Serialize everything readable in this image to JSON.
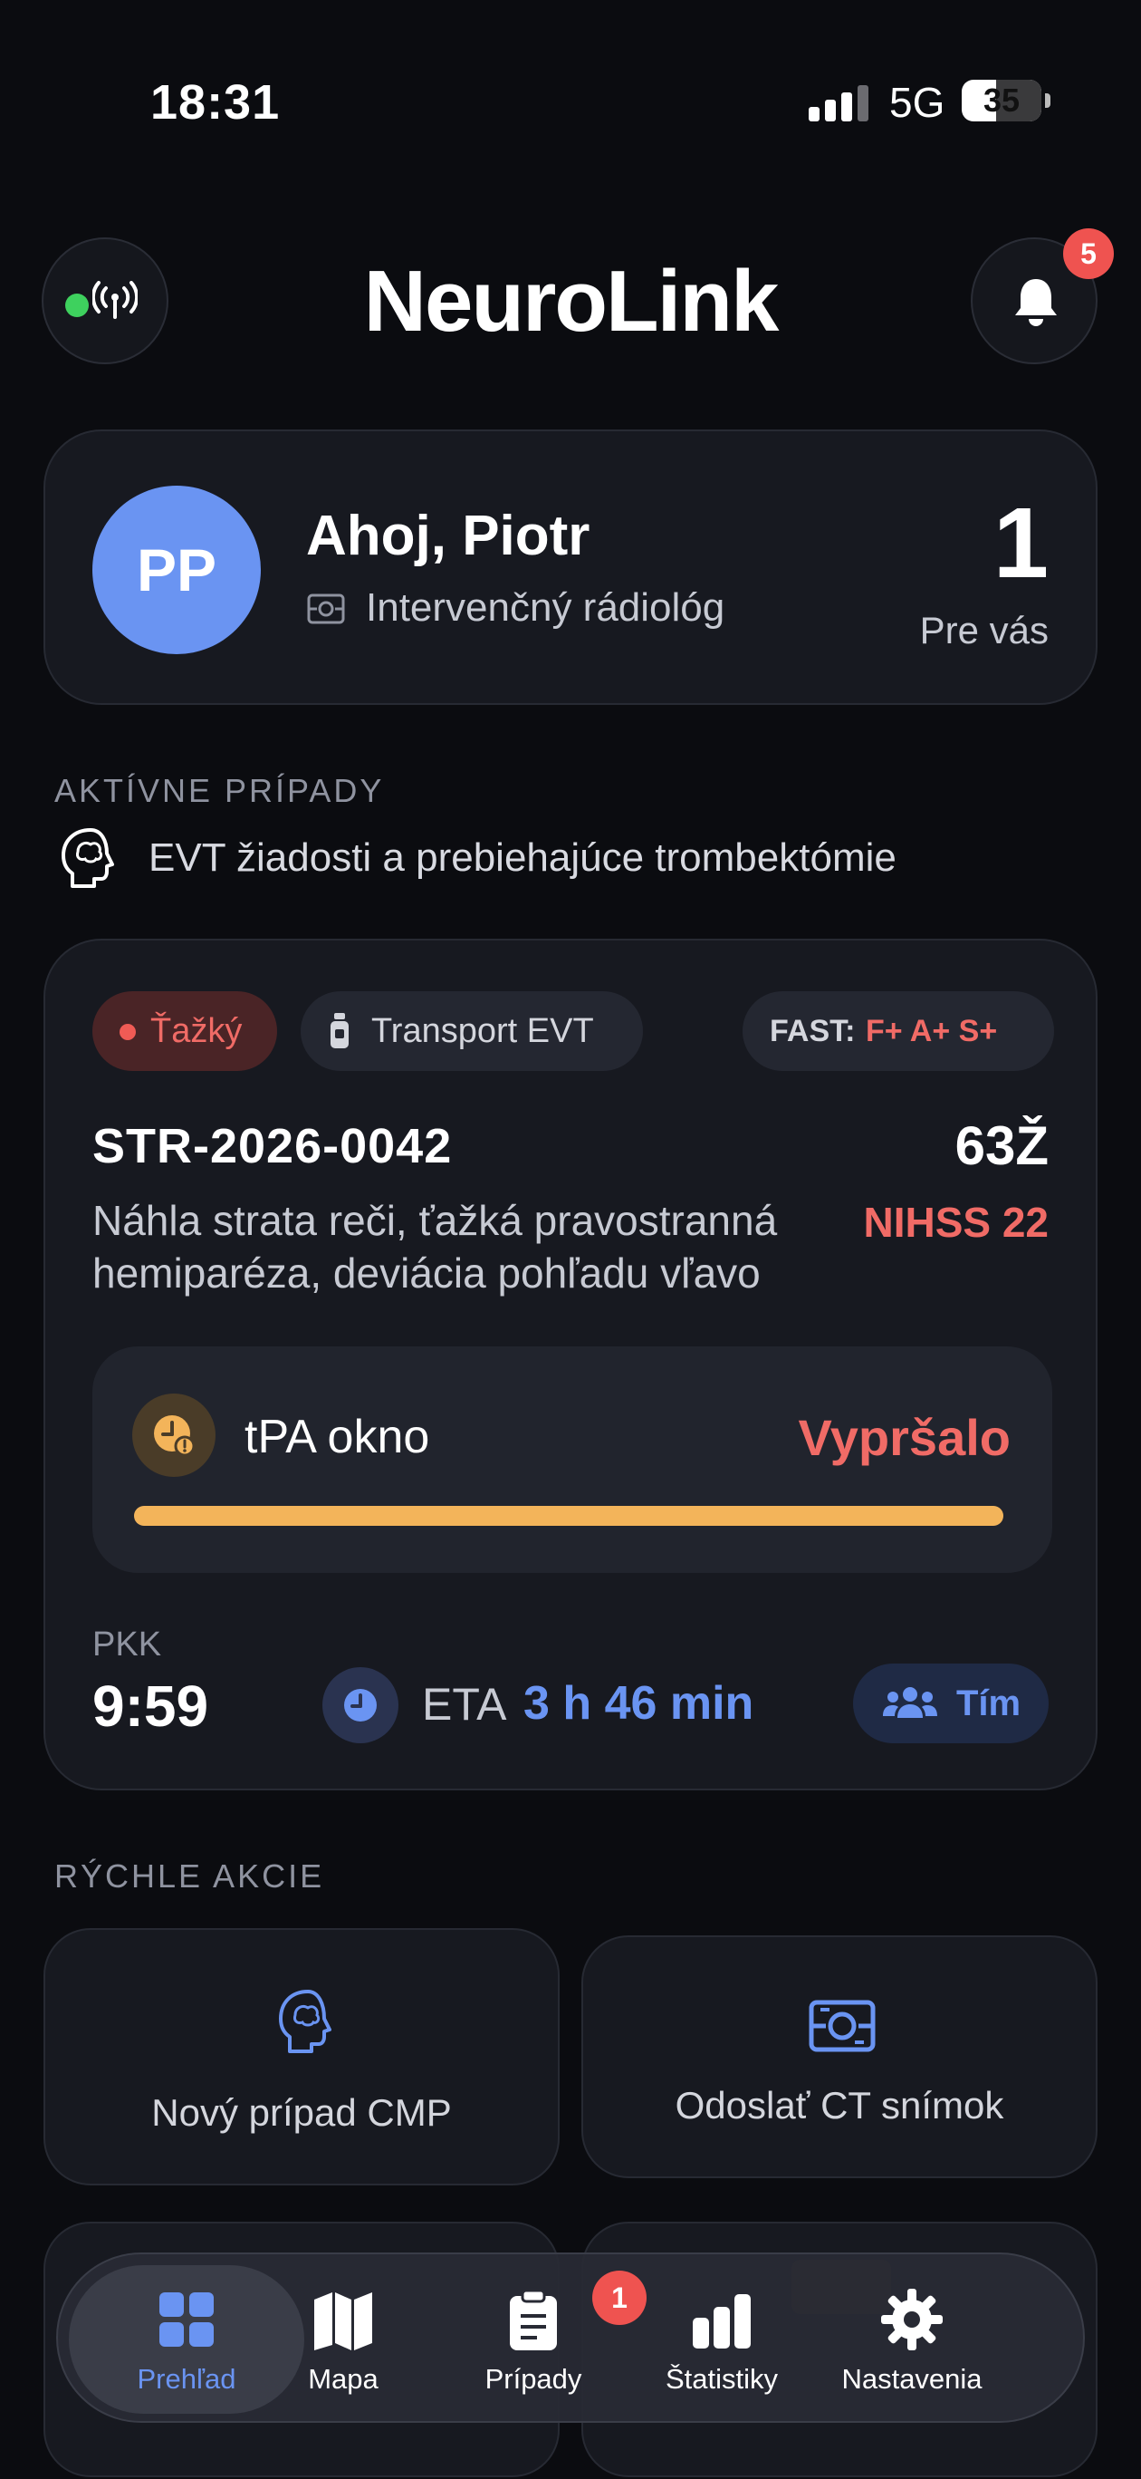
{
  "status_bar": {
    "time": "18:31",
    "network": "5G",
    "battery": "35"
  },
  "header": {
    "title": "NeuroLink",
    "notification_count": "5"
  },
  "greeting": {
    "avatar_initials": "PP",
    "name": "Ahoj, Piotr",
    "role": "Intervenčný rádiológ",
    "count": "1",
    "count_label": "Pre vás"
  },
  "active_section": {
    "label": "AKTÍVNE PRÍPADY",
    "subtitle": "EVT žiadosti a prebiehajúce trombektómie"
  },
  "case": {
    "severity": "Ťažký",
    "transport": "Transport EVT",
    "fast_label": "FAST:",
    "fast_value": "F+ A+ S+",
    "id": "STR-2026-0042",
    "age_sex": "63Ž",
    "description": "Náhla strata reči, ťažká pravostranná hemiparéza, deviácia pohľadu vľavo",
    "nihss": "NIHSS 22",
    "tpa_label": "tPA okno",
    "tpa_status": "Vypršalo",
    "tpa_progress": 1.0,
    "pkk_label": "PKK",
    "pkk_value": "9:59",
    "eta_label": "ETA",
    "eta_value": "3 h 46 min",
    "team_label": "Tím"
  },
  "quick_actions": {
    "label": "RÝCHLE AKCIE",
    "items": [
      {
        "label": "Nový prípad CMP",
        "icon": "brain-icon"
      },
      {
        "label": "Odoslať CT snímok",
        "icon": "ct-scan-icon"
      }
    ]
  },
  "tabbar": {
    "items": [
      {
        "label": "Prehľad",
        "icon": "dashboard-icon",
        "active": true
      },
      {
        "label": "Mapa",
        "icon": "map-icon"
      },
      {
        "label": "Prípady",
        "icon": "clipboard-icon",
        "badge": "1"
      },
      {
        "label": "Štatistiky",
        "icon": "bar-chart-icon"
      },
      {
        "label": "Nastavenia",
        "icon": "gear-icon"
      }
    ]
  },
  "colors": {
    "accent": "#6a94f2",
    "danger": "#f06b66",
    "warning": "#f3b45a",
    "online": "#3ed15e",
    "background": "#0b0c10"
  }
}
